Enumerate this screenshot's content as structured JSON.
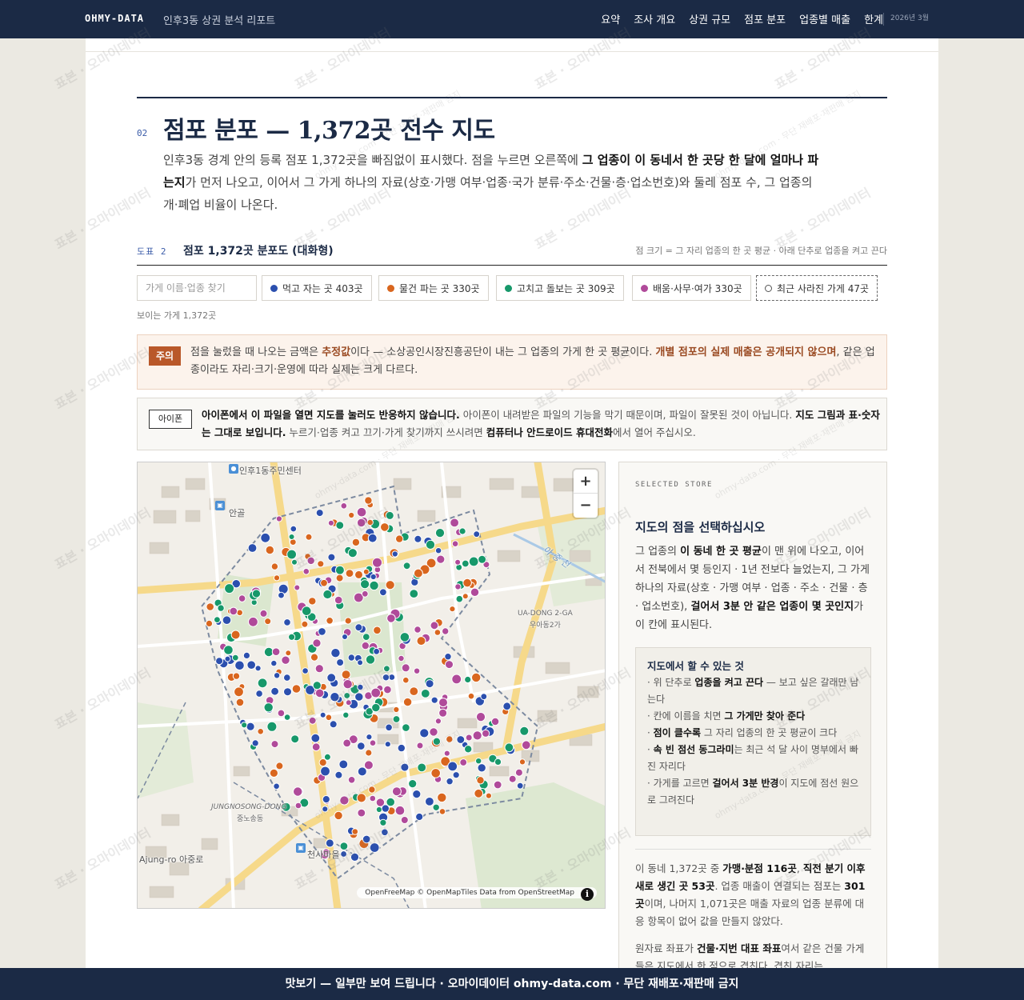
{
  "header": {
    "brand": "OHMY-DATA",
    "report_title": "인후3동 상권 분석 리포트",
    "nav": [
      "요약",
      "조사 개요",
      "상권 규모",
      "점포 분포",
      "업종별 매출",
      "한계"
    ],
    "date": "2026년 3월"
  },
  "section": {
    "number": "02",
    "title": "점포 분포 — 1,372곳 전수 지도",
    "desc_1": "인후3동 경계 안의 등록 점포 1,372곳을 빠짐없이 표시했다. 점을 누르면 오른쪽에 ",
    "desc_bold": "그 업종이 이 동네서 한 곳당 한 달에 얼마나 파는지",
    "desc_2": "가 먼저 나오고, 이어서 그 가게 하나의 자료(상호·가맹 여부·업종·국가 분류·주소·건물·층·업소번호)와 둘레 점포 수, 그 업종의 개·폐업 비율이 나온다."
  },
  "figure": {
    "number": "도표 2",
    "title": "점포 1,372곳 분포도 (대화형)",
    "note": "점 크기 = 그 자리 업종의 한 곳 평균 · 아래 단추로 업종을 켜고 끈다"
  },
  "filters": {
    "search_placeholder": "가게 이름·업종 찾기",
    "chips": [
      {
        "label": "먹고 자는 곳 403곳",
        "color": "#2b4fae"
      },
      {
        "label": "물건 파는 곳 330곳",
        "color": "#d9661e"
      },
      {
        "label": "고치고 돌보는 곳 309곳",
        "color": "#17986a"
      },
      {
        "label": "배움·사무·여가 330곳",
        "color": "#b04a9a"
      }
    ],
    "closed_chip": "최근 사라진 가게 47곳",
    "visible_count": "보이는 가게 1,372곳"
  },
  "notice": {
    "badge": "주의",
    "text_1": "점을 눌렀을 때 나오는 금액은 ",
    "bold_1": "추정값",
    "text_2": "이다 — 소상공인시장진흥공단이 내는 그 업종의 가게 한 곳 평균이다. ",
    "bold_2": "개별 점포의 실제 매출은 공개되지 않으며",
    "text_3": ", 같은 업종이라도 자리·크기·운영에 따라 실제는 크게 다르다."
  },
  "ios": {
    "badge": "아이폰",
    "bold_1": "아이폰에서 이 파일을 열면 지도를 눌러도 반응하지 않습니다.",
    "text_1": " 아이폰이 내려받은 파일의 기능을 막기 때문이며, 파일이 잘못된 것이 아닙니다. ",
    "bold_2": "지도 그림과 표·숫자는 그대로 보입니다.",
    "text_2": " 누르기·업종 켜고 끄기·가게 찾기까지 쓰시려면 ",
    "bold_3": "컴퓨터나 안드로이드 휴대전화",
    "text_3": "에서 열어 주십시오."
  },
  "map": {
    "labels": {
      "community_center": "인후1동주민센터",
      "angol": "안골",
      "stream": "아 중 천",
      "uadong_en": "UA-DONG 2-GA",
      "uadong_ko": "우아동2가",
      "jungnosong_en": "JUNGNOSONG-DONG",
      "jungnosong_ko": "중노송동",
      "cheonsa": "천사마을",
      "ajung_ro": "Ajung-ro 아중로"
    },
    "attribution": "OpenFreeMap © OpenMapTiles Data from OpenStreetMap",
    "zoom_in": "+",
    "zoom_out": "−",
    "info": "i"
  },
  "panel": {
    "eyebrow": "SELECTED STORE",
    "title": "지도의 점을 선택하십시오",
    "desc_1": "그 업종의 ",
    "desc_b1": "이 동네 한 곳 평균",
    "desc_2": "이 맨 위에 나오고, 이어서 전북에서 몇 등인지 · 1년 전보다 늘었는지, 그 가게 하나의 자료(상호 · 가맹 여부 · 업종 · 주소 · 건물 · 층 · 업소번호), ",
    "desc_b2": "걸어서 3분 안 같은 업종이 몇 곳인지",
    "desc_3": "가 이 칸에 표시된다.",
    "howto_title": "지도에서 할 수 있는 것",
    "howto": [
      {
        "pre": "· 위 단추로 ",
        "b": "업종을 켜고 끈다",
        "post": " — 보고 싶은 갈래만 남는다"
      },
      {
        "pre": "· 칸에 이름을 치면 ",
        "b": "그 가게만 찾아 준다",
        "post": ""
      },
      {
        "pre": "· ",
        "b": "점이 클수록",
        "post": " 그 자리 업종의 한 곳 평균이 크다"
      },
      {
        "pre": "· ",
        "b": "속 빈 점선 동그라미",
        "post": "는 최근 석 달 사이 명부에서 빠진 자리다"
      },
      {
        "pre": "· 가게를 고르면 ",
        "b": "걸어서 3분 반경",
        "post": "이 지도에 점선 원으로 그려진다"
      }
    ],
    "stats_1": "이 동네 1,372곳 중 ",
    "stats_b1": "가맹·분점 116곳",
    "stats_2": ", ",
    "stats_b2": "직전 분기 이후 새로 생긴 곳 53곳",
    "stats_3": ". 업종 매출이 연결되는 점포는 ",
    "stats_b3": "301곳",
    "stats_4": "이며, 나머지 1,071곳은 매출 자료의 업종 분류에 대응 항목이 없어 값을 만들지 않았다.",
    "source_1": "원자료 좌표가 ",
    "source_b": "건물·지번 대표 좌표",
    "source_2": "여서 같은 건물 가게들은 지도에서 한 점으로 겹친다. 겹친 자리는"
  },
  "footer": "맛보기 — 일부만 보여 드립니다 · 오마이데이터 ohmy-data.com · 무단 재배포·재판매 금지",
  "watermarks": {
    "main": "표본 · 오마이데이터",
    "side": "ohmy-data.com · 무단 재배포·재판매 금지"
  },
  "colors": {
    "navy": "#1b2a45",
    "food": "#2b4fae",
    "retail": "#d9661e",
    "service": "#17986a",
    "office": "#b04a9a"
  }
}
